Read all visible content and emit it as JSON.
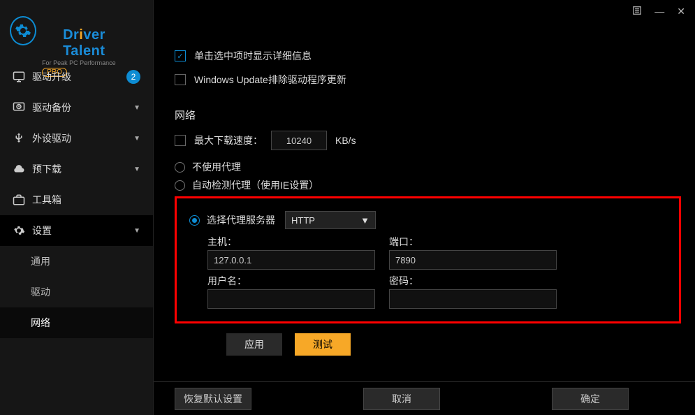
{
  "app": {
    "name_parts": [
      "Dr",
      "i",
      "ver Talent"
    ],
    "tagline": "For Peak PC Performance",
    "edition": "PRO"
  },
  "sidebar": {
    "items": [
      {
        "icon": "monitor",
        "label": "驱动升级",
        "badge": "2"
      },
      {
        "icon": "monitor-clock",
        "label": "驱动备份",
        "chevron": true
      },
      {
        "icon": "usb",
        "label": "外设驱动",
        "chevron": true
      },
      {
        "icon": "cloud",
        "label": "预下载",
        "chevron": true
      },
      {
        "icon": "briefcase",
        "label": "工具箱"
      },
      {
        "icon": "gear",
        "label": "设置",
        "chevron": true,
        "active": true
      }
    ],
    "sub_items": [
      {
        "label": "通用"
      },
      {
        "label": "驱动"
      },
      {
        "label": "网络",
        "active": true
      }
    ]
  },
  "settings": {
    "show_detail_checkbox": {
      "checked": true,
      "label": "单击选中项时显示详细信息"
    },
    "exclude_wu_checkbox": {
      "checked": false,
      "label": "Windows Update排除驱动程序更新"
    },
    "network_section_title": "网络",
    "max_speed": {
      "label": "最大下载速度：",
      "value": "10240",
      "unit": "KB/s",
      "checked": false
    },
    "proxy": {
      "options": {
        "none": "不使用代理",
        "auto": "自动检测代理（使用IE设置）",
        "select": "选择代理服务器"
      },
      "selected": "select",
      "protocol": "HTTP",
      "host_label": "主机：",
      "host": "127.0.0.1",
      "port_label": "端口：",
      "port": "7890",
      "user_label": "用户名：",
      "user": "",
      "pass_label": "密码：",
      "pass": ""
    },
    "buttons": {
      "apply": "应用",
      "test": "测试"
    },
    "bottom": {
      "reset": "恢复默认设置",
      "cancel": "取消",
      "ok": "确定"
    }
  }
}
